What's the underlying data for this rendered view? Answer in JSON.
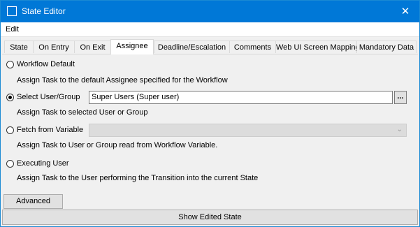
{
  "window": {
    "title": "State Editor",
    "close_glyph": "✕"
  },
  "menu": {
    "edit": "Edit"
  },
  "tabs": [
    "State",
    "On Entry",
    "On Exit",
    "Assignee",
    "Deadline/Escalation",
    "Comments",
    "Web UI Screen Mapping",
    "Mandatory Data"
  ],
  "active_tab": "Assignee",
  "assignee": {
    "workflow_default": {
      "label": "Workflow Default",
      "desc": "Assign Task to the default Assignee specified for the Workflow",
      "checked": false
    },
    "select_user_group": {
      "label": "Select User/Group",
      "value": "Super Users (Super user)",
      "browse": "...",
      "desc": "Assign Task to selected User or Group",
      "checked": true
    },
    "fetch_from_variable": {
      "label": "Fetch from Variable",
      "value": "",
      "desc": "Assign Task to User or Group read from Workflow Variable.",
      "checked": false
    },
    "executing_user": {
      "label": "Executing User",
      "desc": "Assign Task to the User performing the Transition into the current State",
      "checked": false
    }
  },
  "buttons": {
    "advanced": "Advanced",
    "show_edited_state": "Show Edited State"
  },
  "icons": {
    "window": "window-icon",
    "close": "close-icon",
    "dropdown": "chevron-down-icon"
  }
}
